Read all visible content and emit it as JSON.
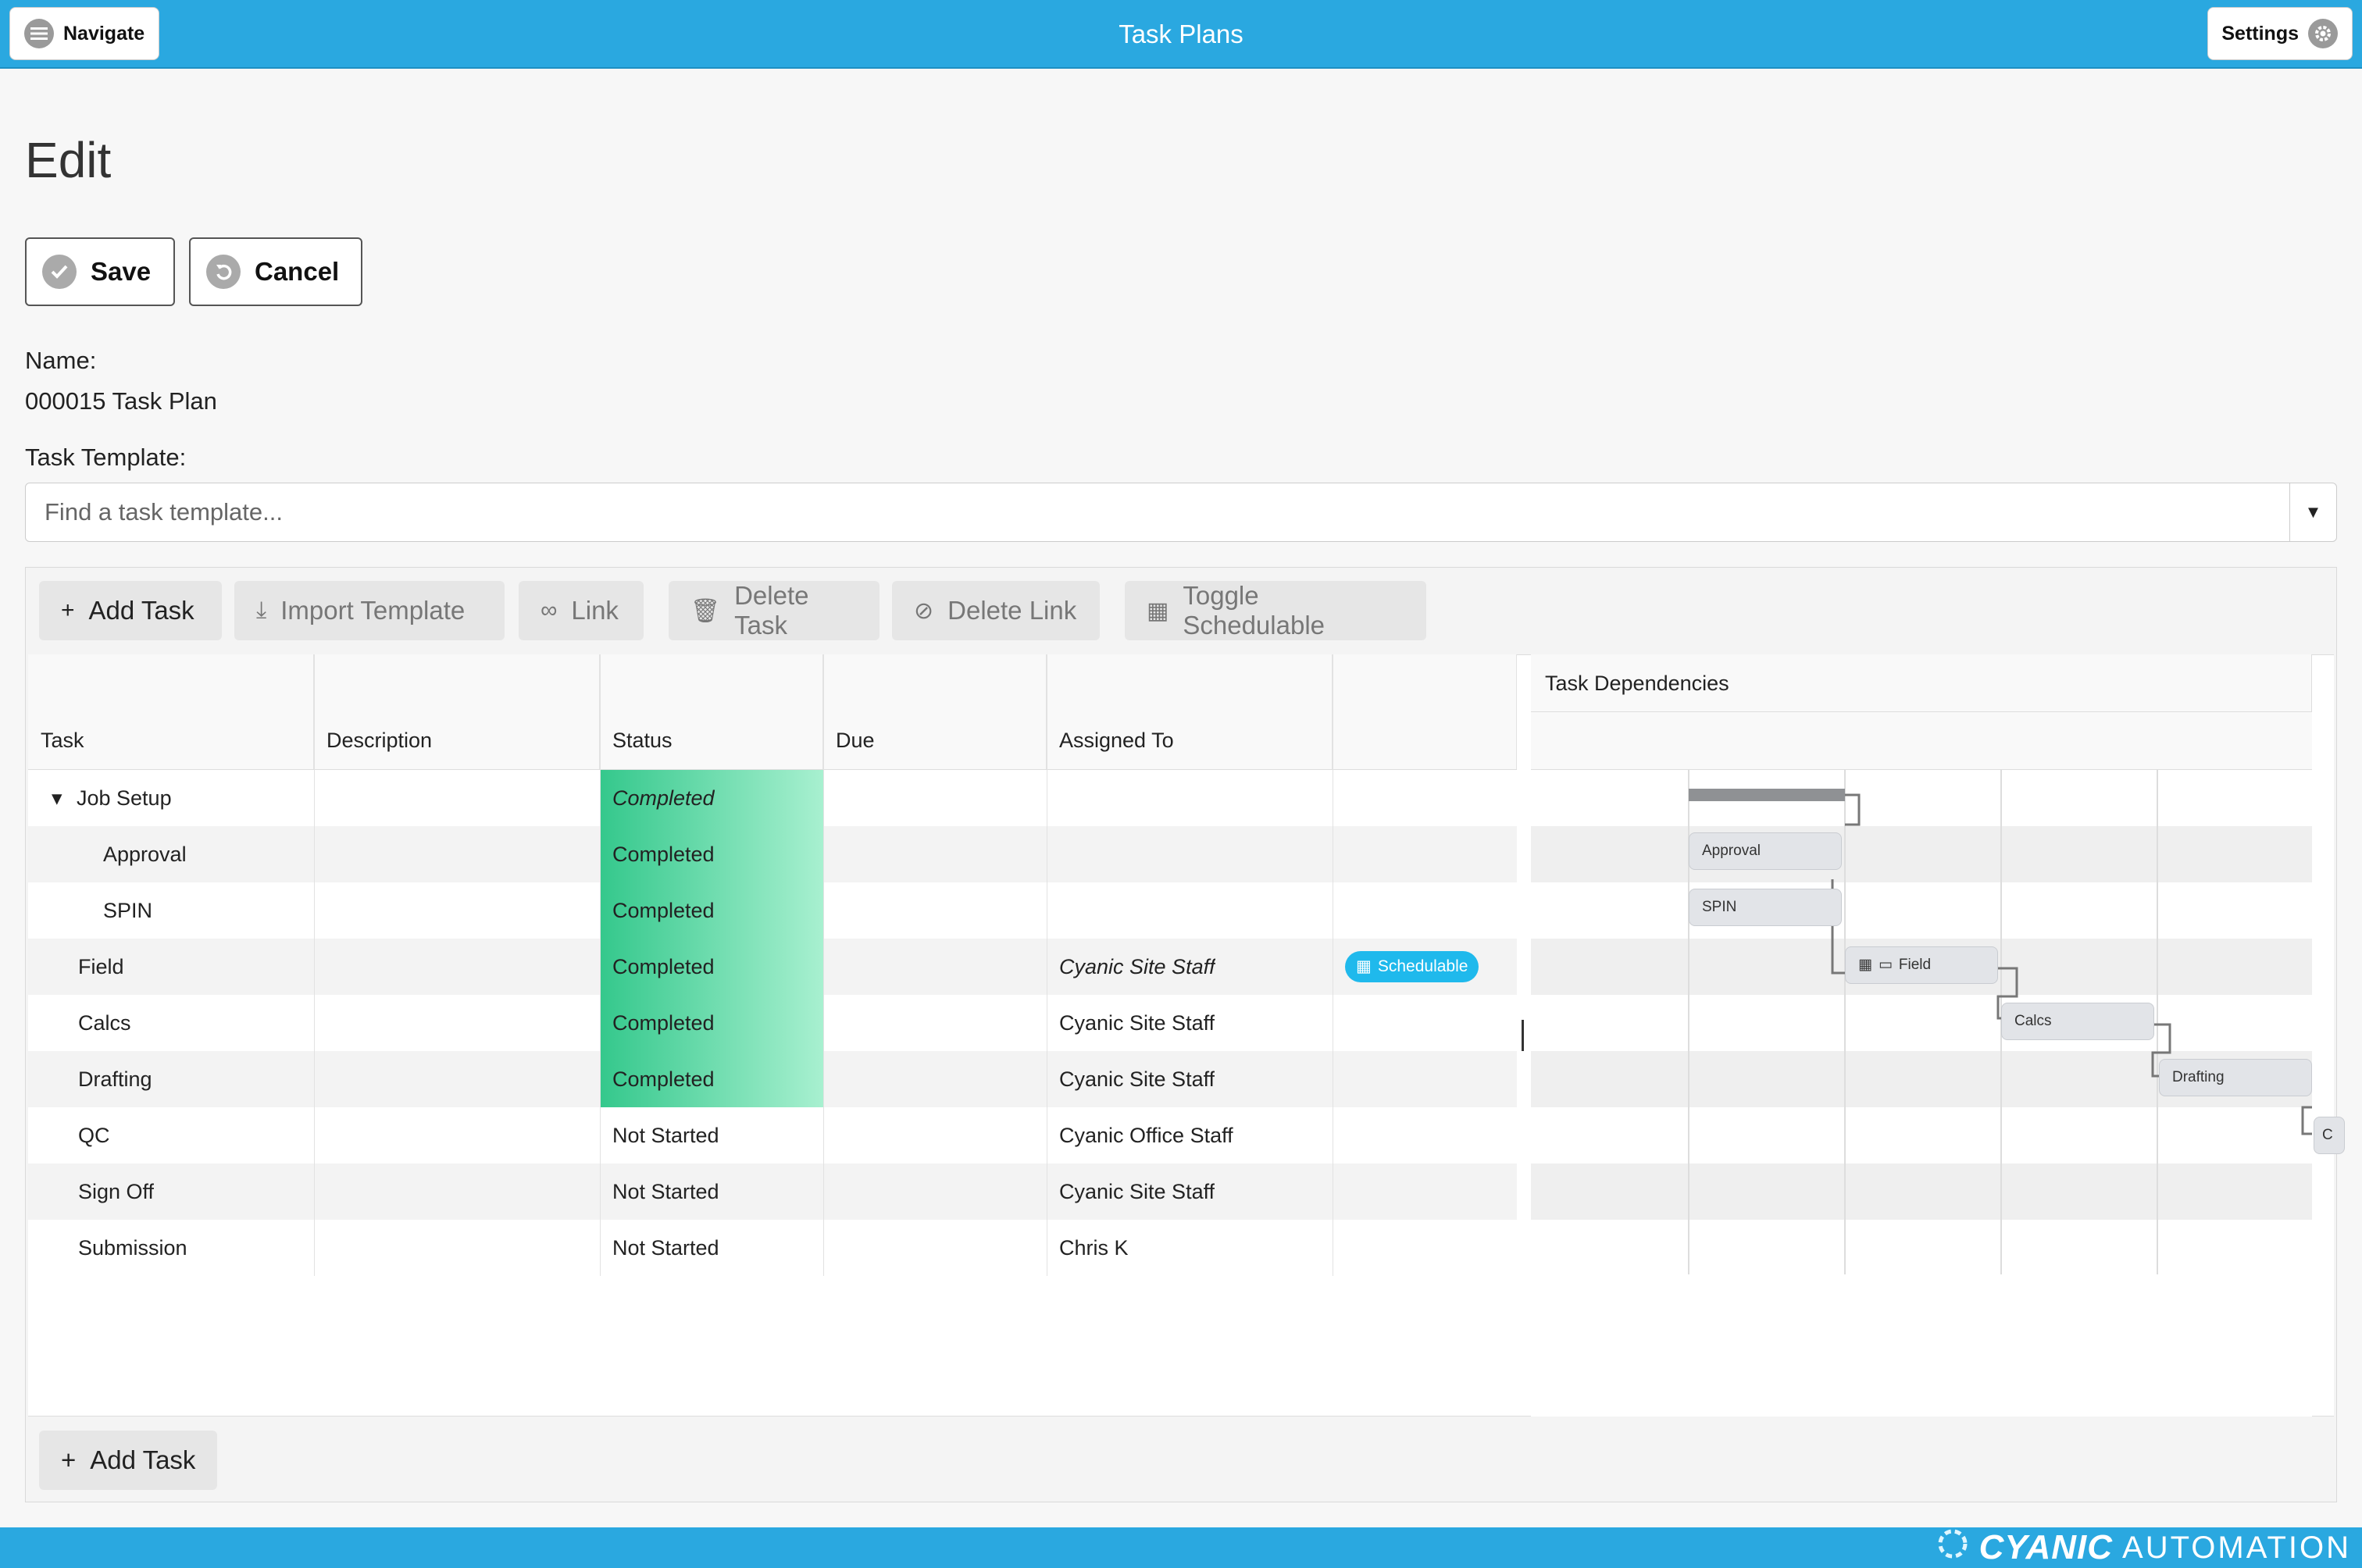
{
  "header": {
    "title": "Task Plans",
    "navigate_label": "Navigate",
    "settings_label": "Settings"
  },
  "page": {
    "title": "Edit",
    "save_label": "Save",
    "cancel_label": "Cancel",
    "name_label": "Name:",
    "name_value": "000015 Task Plan",
    "template_label": "Task Template:",
    "template_placeholder": "Find a task template..."
  },
  "toolbar": {
    "add_task": "Add Task",
    "import_template": "Import Template",
    "link": "Link",
    "delete_task": "Delete Task",
    "delete_link": "Delete Link",
    "toggle_schedulable": "Toggle Schedulable"
  },
  "columns": {
    "task": "Task",
    "description": "Description",
    "status": "Status",
    "due": "Due",
    "assigned_to": "Assigned To",
    "dependencies": "Task Dependencies"
  },
  "rows": [
    {
      "task": "Job Setup",
      "status": "Completed",
      "assigned": ""
    },
    {
      "task": "Approval",
      "status": "Completed",
      "assigned": ""
    },
    {
      "task": "SPIN",
      "status": "Completed",
      "assigned": ""
    },
    {
      "task": "Field",
      "status": "Completed",
      "assigned": "Cyanic Site Staff",
      "badge": "Schedulable"
    },
    {
      "task": "Calcs",
      "status": "Completed",
      "assigned": "Cyanic Site Staff"
    },
    {
      "task": "Drafting",
      "status": "Completed",
      "assigned": "Cyanic Site Staff"
    },
    {
      "task": "QC",
      "status": "Not Started",
      "assigned": "Cyanic Office Staff"
    },
    {
      "task": "Sign Off",
      "status": "Not Started",
      "assigned": "Cyanic Site Staff"
    },
    {
      "task": "Submission",
      "status": "Not Started",
      "assigned": "Chris K"
    }
  ],
  "gantt": {
    "approval": "Approval",
    "spin": "SPIN",
    "field": "Field",
    "calcs": "Calcs",
    "drafting": "Drafting",
    "qc_partial": "C"
  },
  "bottom": {
    "add_task": "Add Task"
  },
  "footer": {
    "brand_a": "CYANIC",
    "brand_b": "AUTOMATION"
  }
}
